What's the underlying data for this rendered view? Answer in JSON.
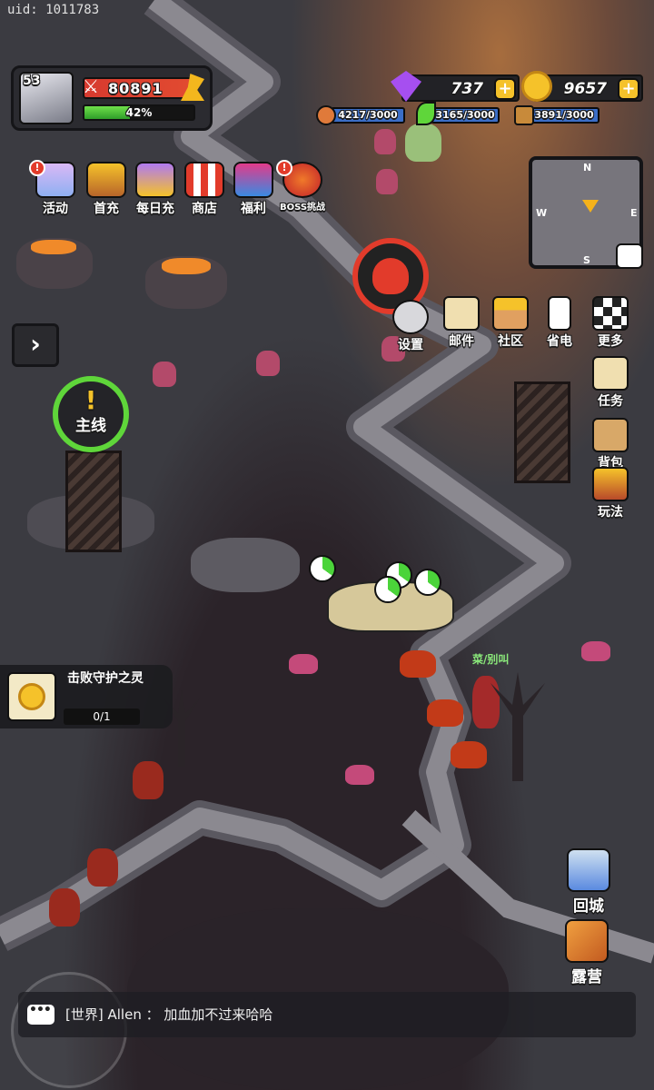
{
  "uid": "uid: 1011783",
  "player": {
    "level": "53",
    "power": "80891",
    "exp_percent": "42%",
    "exp_fraction": 0.42
  },
  "currencies": {
    "gems": "737",
    "gold": "9657"
  },
  "resources": [
    {
      "name": "meat",
      "label": "4217/3000",
      "fraction": 1.0,
      "color": "#3b6ec7"
    },
    {
      "name": "herb",
      "label": "3165/3000",
      "fraction": 1.0,
      "color": "#3b6ec7"
    },
    {
      "name": "wood",
      "label": "3891/3000",
      "fraction": 1.0,
      "color": "#3b6ec7"
    }
  ],
  "top_menu": [
    {
      "label": "活动",
      "icon": "activity-icon",
      "badge": "!"
    },
    {
      "label": "首充",
      "icon": "first-recharge-icon",
      "badge": ""
    },
    {
      "label": "每日充",
      "icon": "daily-recharge-icon",
      "badge": ""
    },
    {
      "label": "商店",
      "icon": "shop-icon",
      "badge": ""
    },
    {
      "label": "福利",
      "icon": "welfare-gift-icon",
      "badge": ""
    },
    {
      "label": "BOSS挑战",
      "icon": "boss-challenge-icon",
      "badge": "!"
    }
  ],
  "minimap": {
    "north": "N",
    "south": "S",
    "west": "W",
    "east": "E"
  },
  "side_menu": [
    {
      "label": "设置",
      "icon": "settings-gear-icon"
    },
    {
      "label": "邮件",
      "icon": "mail-icon"
    },
    {
      "label": "社区",
      "icon": "community-house-icon"
    },
    {
      "label": "省电",
      "icon": "battery-icon"
    },
    {
      "label": "更多",
      "icon": "more-grid-icon"
    }
  ],
  "right_menu": [
    {
      "label": "任务",
      "icon": "task-scroll-icon"
    },
    {
      "label": "背包",
      "icon": "backpack-icon"
    },
    {
      "label": "玩法",
      "icon": "gameplay-icon"
    }
  ],
  "main_quest": {
    "mark": "!",
    "label": "主线"
  },
  "quest_card": {
    "title": "击败守护之灵",
    "progress": "0/1"
  },
  "npc_name": "菜/别叫",
  "bottom_buttons": [
    {
      "label": "回城",
      "icon": "return-town-portal-icon"
    },
    {
      "label": "露营",
      "icon": "camp-tent-icon"
    }
  ],
  "chat": {
    "channel": "[世界]",
    "author": "Allen",
    "message": "加血加不过来哈哈"
  },
  "colors": {
    "accent_red": "#e23b2b",
    "accent_green": "#5fd63a",
    "gold": "#f5c22a",
    "gem": "#a64ff0"
  }
}
